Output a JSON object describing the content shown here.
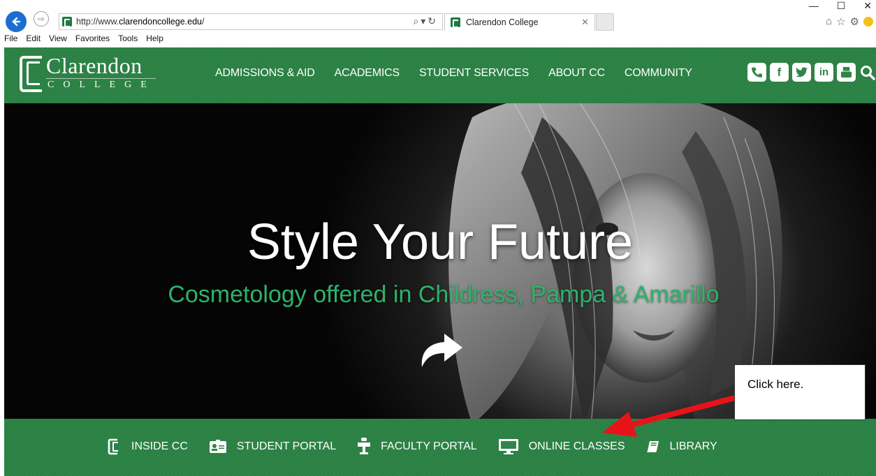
{
  "browser": {
    "url_prefix": "http://www.",
    "url_domain": "clarendoncollege.edu",
    "url_suffix": "/",
    "tab_title": "Clarendon College",
    "menu": [
      "File",
      "Edit",
      "View",
      "Favorites",
      "Tools",
      "Help"
    ]
  },
  "header": {
    "logo_name": "Clarendon",
    "logo_sub": "COLLEGE",
    "nav": [
      "ADMISSIONS & AID",
      "ACADEMICS",
      "STUDENT SERVICES",
      "ABOUT CC",
      "COMMUNITY"
    ],
    "social": [
      "phone-icon",
      "facebook-icon",
      "twitter-icon",
      "linkedin-icon",
      "youtube-icon",
      "search-icon"
    ]
  },
  "hero": {
    "title": "Style Your Future",
    "subtitle": "Cosmetology offered in Childress, Pampa & Amarillo"
  },
  "callout": {
    "text": "Click here."
  },
  "quicklinks": [
    {
      "label": "INSIDE CC",
      "icon": "college-logo-icon"
    },
    {
      "label": "STUDENT PORTAL",
      "icon": "id-card-icon"
    },
    {
      "label": "FACULTY PORTAL",
      "icon": "podium-icon"
    },
    {
      "label": "ONLINE CLASSES",
      "icon": "monitor-icon"
    },
    {
      "label": "LIBRARY",
      "icon": "book-icon"
    }
  ],
  "colors": {
    "brand_green": "#2f8648",
    "subtitle_green": "#2db36a",
    "annotation_red": "#e8131a"
  }
}
